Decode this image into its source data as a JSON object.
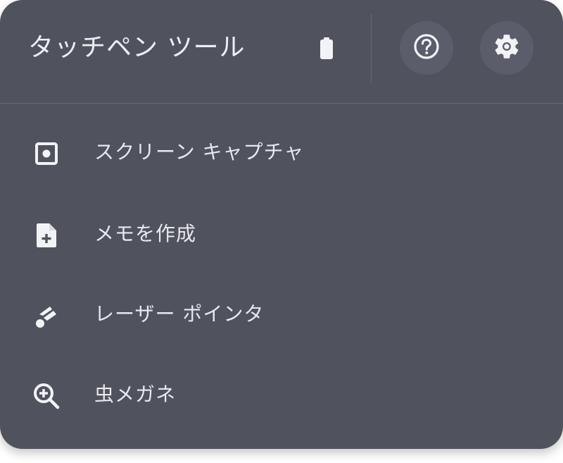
{
  "header": {
    "title": "タッチペン ツール",
    "battery_icon": "battery-icon",
    "help_icon": "help-icon",
    "settings_icon": "gear-icon"
  },
  "menu": {
    "items": [
      {
        "label": "スクリーン キャプチャ",
        "icon": "screen-capture-icon"
      },
      {
        "label": "メモを作成",
        "icon": "note-add-icon"
      },
      {
        "label": "レーザー ポインタ",
        "icon": "laser-pointer-icon"
      },
      {
        "label": "虫メガネ",
        "icon": "magnifier-icon"
      }
    ]
  },
  "colors": {
    "panel_background": "#50525d",
    "button_background": "#5b5e6a",
    "text": "#e8e9ee"
  }
}
